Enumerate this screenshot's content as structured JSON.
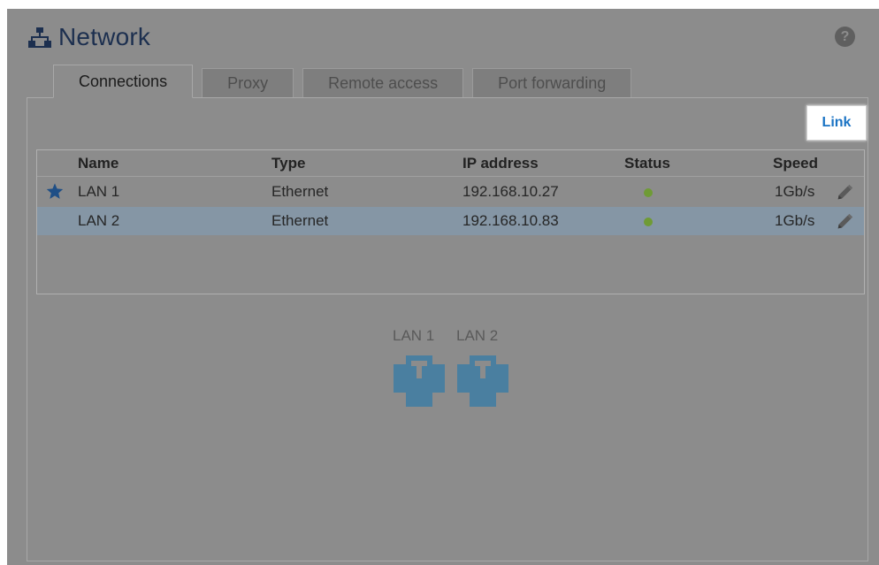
{
  "header": {
    "title": "Network",
    "title_icon": "network-icon",
    "help_icon": "help-icon",
    "help_glyph": "?"
  },
  "tabs": [
    {
      "label": "Connections",
      "active": true
    },
    {
      "label": "Proxy",
      "active": false
    },
    {
      "label": "Remote access",
      "active": false
    },
    {
      "label": "Port forwarding",
      "active": false
    }
  ],
  "toolbar": {
    "link_label": "Link"
  },
  "table": {
    "columns": [
      "Name",
      "Type",
      "IP address",
      "Status",
      "Speed"
    ],
    "rows": [
      {
        "name": "LAN 1",
        "type": "Ethernet",
        "ip": "192.168.10.27",
        "status": "connected",
        "speed": "1Gb/s",
        "primary": true,
        "selected": false
      },
      {
        "name": "LAN 2",
        "type": "Ethernet",
        "ip": "192.168.10.83",
        "status": "connected",
        "speed": "1Gb/s",
        "primary": false,
        "selected": true
      }
    ]
  },
  "ports": [
    {
      "label": "LAN 1",
      "icon": "ethernet-port-icon"
    },
    {
      "label": "LAN 2",
      "icon": "ethernet-port-icon"
    }
  ],
  "colors": {
    "accent": "#1a73c4",
    "status_ok": "#6f9b35",
    "port": "#4a7fa0",
    "selected_row": "#8596a5",
    "star": "#1f4f86"
  }
}
